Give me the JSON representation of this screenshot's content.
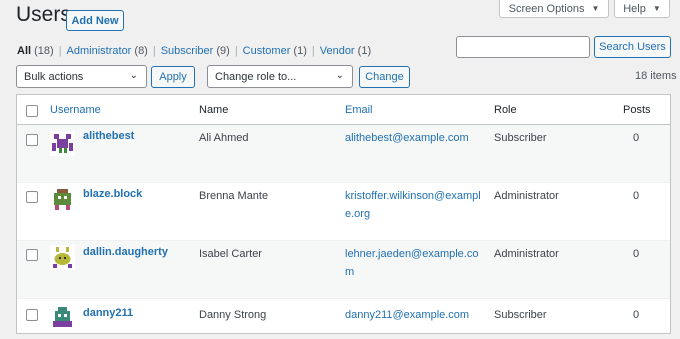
{
  "page": {
    "title": "Users",
    "add_new_label": "Add New"
  },
  "tabs": {
    "screen_options": "Screen Options",
    "help": "Help"
  },
  "filters": [
    {
      "label": "All",
      "count": "(18)"
    },
    {
      "label": "Administrator",
      "count": "(8)"
    },
    {
      "label": "Subscriber",
      "count": "(9)"
    },
    {
      "label": "Customer",
      "count": "(1)"
    },
    {
      "label": "Vendor",
      "count": "(1)"
    }
  ],
  "search": {
    "button_label": "Search Users",
    "value": ""
  },
  "bulk_actions": {
    "selected": "Bulk actions",
    "apply_label": "Apply"
  },
  "change_role": {
    "selected": "Change role to...",
    "change_label": "Change"
  },
  "items_count": "18 items",
  "table": {
    "columns": {
      "username": "Username",
      "name": "Name",
      "email": "Email",
      "role": "Role",
      "posts": "Posts"
    },
    "rows": [
      {
        "username": "alithebest",
        "name": "Ali Ahmed",
        "email_line1": "alithebest@example.com",
        "email_line2": "",
        "role": "Subscriber",
        "posts": "0",
        "avatar_color": "#7b3fa0"
      },
      {
        "username": "blaze.block",
        "name": "Brenna Mante",
        "email_line1": "kristoffer.wilkinson@exampl",
        "email_line2": "e.org",
        "role": "Administrator",
        "posts": "0",
        "avatar_color": "#5a8a3a"
      },
      {
        "username": "dallin.daugherty",
        "name": "Isabel Carter",
        "email_line1": "lehner.jaeden@example.co",
        "email_line2": "m",
        "role": "Administrator",
        "posts": "0",
        "avatar_color": "#b7b83a"
      },
      {
        "username": "danny211",
        "name": "Danny Strong",
        "email_line1": "danny211@example.com",
        "email_line2": "",
        "role": "Subscriber",
        "posts": "0",
        "avatar_color": "#3a8a7a"
      }
    ]
  },
  "icons": {
    "caret": "caret-down-icon",
    "chevron": "chevron-down-icon",
    "avatar": "identicon-avatar"
  }
}
